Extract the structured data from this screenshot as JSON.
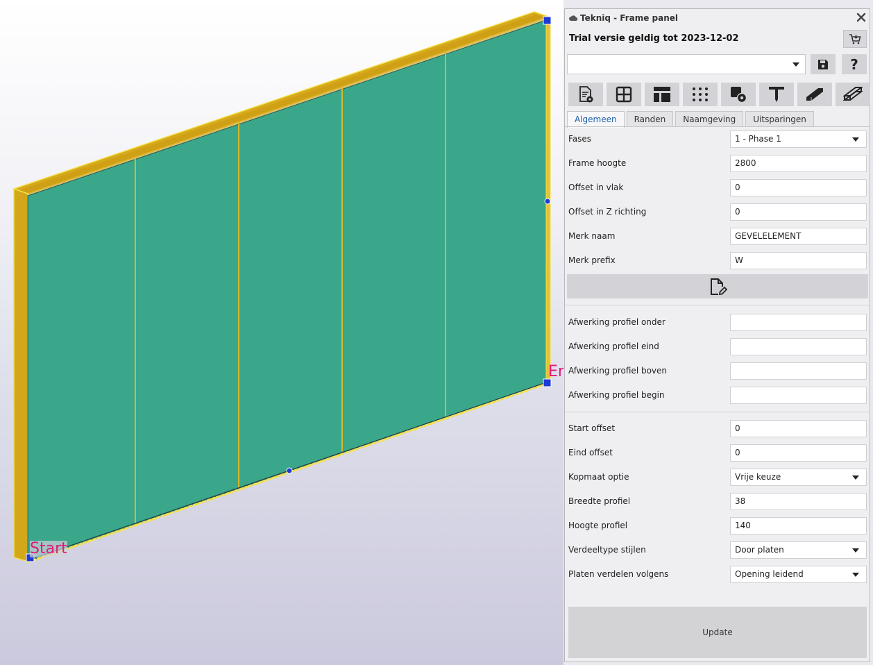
{
  "viewport": {
    "label_start": "Start",
    "label_end": "Er",
    "colors": {
      "panel_fill": "#3aa68a",
      "frame": "#d6aa1c",
      "handle": "#1e3ad6"
    }
  },
  "panel": {
    "title": "Tekniq - Frame panel",
    "trial_text": "Trial versie geldig tot 2023-12-02",
    "preset_value": "",
    "help_label": "?",
    "toolbar_icons": [
      "document-settings-icon",
      "grid-icon",
      "layout-icon",
      "dots-grid-icon",
      "shape-settings-icon",
      "t-profile-icon",
      "beam-icon",
      "plates-icon"
    ],
    "tabs": [
      {
        "label": "Algemeen",
        "active": true
      },
      {
        "label": "Randen",
        "active": false
      },
      {
        "label": "Naamgeving",
        "active": false
      },
      {
        "label": "Uitsparingen",
        "active": false
      }
    ],
    "fields": {
      "fases": {
        "label": "Fases",
        "value": "1 - Phase 1"
      },
      "frame_hoogte": {
        "label": "Frame hoogte",
        "value": "2800"
      },
      "offset_vlak": {
        "label": "Offset in vlak",
        "value": "0"
      },
      "offset_z": {
        "label": "Offset in Z richting",
        "value": "0"
      },
      "merk_naam": {
        "label": "Merk naam",
        "value": "GEVELELEMENT"
      },
      "merk_prefix": {
        "label": "Merk prefix",
        "value": "W"
      },
      "afw_onder": {
        "label": "Afwerking profiel onder",
        "value": ""
      },
      "afw_eind": {
        "label": "Afwerking profiel eind",
        "value": ""
      },
      "afw_boven": {
        "label": "Afwerking profiel boven",
        "value": ""
      },
      "afw_begin": {
        "label": "Afwerking profiel begin",
        "value": ""
      },
      "start_offset": {
        "label": "Start offset",
        "value": "0"
      },
      "eind_offset": {
        "label": "Eind offset",
        "value": "0"
      },
      "kopmaat": {
        "label": "Kopmaat optie",
        "value": "Vrije keuze"
      },
      "breedte": {
        "label": "Breedte profiel",
        "value": "38"
      },
      "hoogte": {
        "label": "Hoogte profiel",
        "value": "140"
      },
      "verdeeltype": {
        "label": "Verdeeltype stijlen",
        "value": "Door platen"
      },
      "platen_verdelen": {
        "label": "Platen verdelen volgens",
        "value": "Opening leidend"
      }
    },
    "update_label": "Update"
  }
}
